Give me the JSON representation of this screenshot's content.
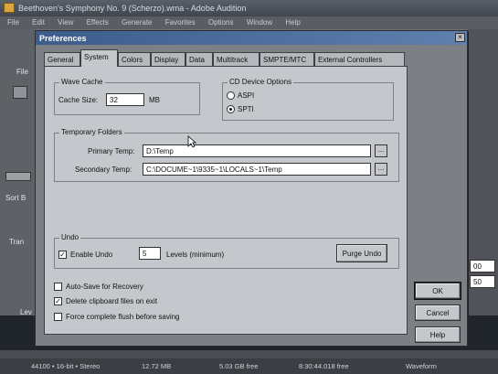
{
  "app": {
    "title": "Beethoven's Symphony No. 9 (Scherzo).wma - Adobe Audition",
    "menu": [
      "File",
      "Edit",
      "View",
      "Effects",
      "Generate",
      "Favorites",
      "Options",
      "Window",
      "Help"
    ],
    "left_labels": [
      "File",
      "Sort B",
      "Tran",
      "Lev"
    ],
    "right_values": [
      "00",
      "50"
    ],
    "status": {
      "rate": "44100 • 16-bit • Stereo",
      "size": "12.72 MB",
      "free": "5.03 GB free",
      "time": "8:30:44.018 free",
      "view": "Waveform"
    }
  },
  "dialog": {
    "title": "Preferences",
    "close_glyph": "×",
    "tabs": [
      "General",
      "System",
      "Colors",
      "Display",
      "Data",
      "Multitrack",
      "SMPTE/MTC",
      "External Controllers"
    ],
    "active_tab": "System",
    "wave_cache": {
      "title": "Wave Cache",
      "cache_size_label": "Cache Size:",
      "cache_size_value": "32",
      "cache_unit": "MB"
    },
    "cd_device": {
      "title": "CD Device Options",
      "options": [
        "ASPI",
        "SPTI"
      ],
      "selected": "SPTI"
    },
    "temp_folders": {
      "title": "Temporary Folders",
      "primary_label": "Primary Temp:",
      "primary_value": "D:\\Temp",
      "secondary_label": "Secondary Temp:",
      "secondary_value": "C:\\DOCUME~1\\9335~1\\LOCALS~1\\Temp",
      "browse_label": "..."
    },
    "undo": {
      "title": "Undo",
      "enable_label": "Enable Undo",
      "enable_checked": true,
      "levels_value": "5",
      "levels_label": "Levels (minimum)",
      "purge_label": "Purge Undo"
    },
    "options": [
      {
        "label": "Auto-Save for Recovery",
        "checked": false
      },
      {
        "label": "Delete clipboard files on exit",
        "checked": true
      },
      {
        "label": "Force complete flush before saving",
        "checked": false
      }
    ],
    "buttons": {
      "ok": "OK",
      "cancel": "Cancel",
      "help": "Help"
    }
  }
}
